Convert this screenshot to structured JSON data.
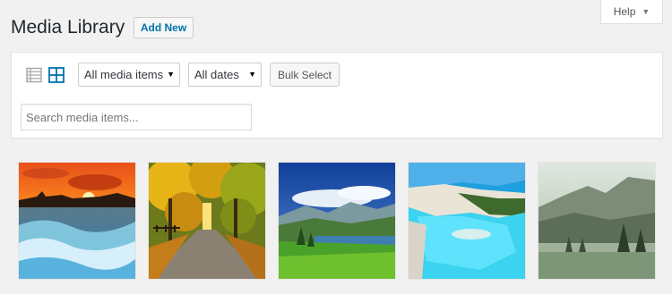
{
  "help": {
    "label": "Help",
    "caret": "▼"
  },
  "header": {
    "title": "Media Library",
    "add_new_label": "Add New"
  },
  "toolbar": {
    "media_filter": {
      "selected": "All media items",
      "arrow": "▼"
    },
    "date_filter": {
      "selected": "All dates",
      "arrow": "▼"
    },
    "bulk_select_label": "Bulk Select",
    "search_placeholder": "Search media items..."
  },
  "icons": {
    "list_view": "list-view-icon",
    "grid_view": "grid-view-icon"
  },
  "colors": {
    "link": "#0073aa",
    "background": "#f1f1f1",
    "active_icon": "#0073aa",
    "inactive_icon": "#a0a5aa"
  },
  "media_items": [
    {
      "subject": "sunset-waves"
    },
    {
      "subject": "autumn-road"
    },
    {
      "subject": "mountain-lake"
    },
    {
      "subject": "turquoise-bay"
    },
    {
      "subject": "misty-valley"
    }
  ]
}
